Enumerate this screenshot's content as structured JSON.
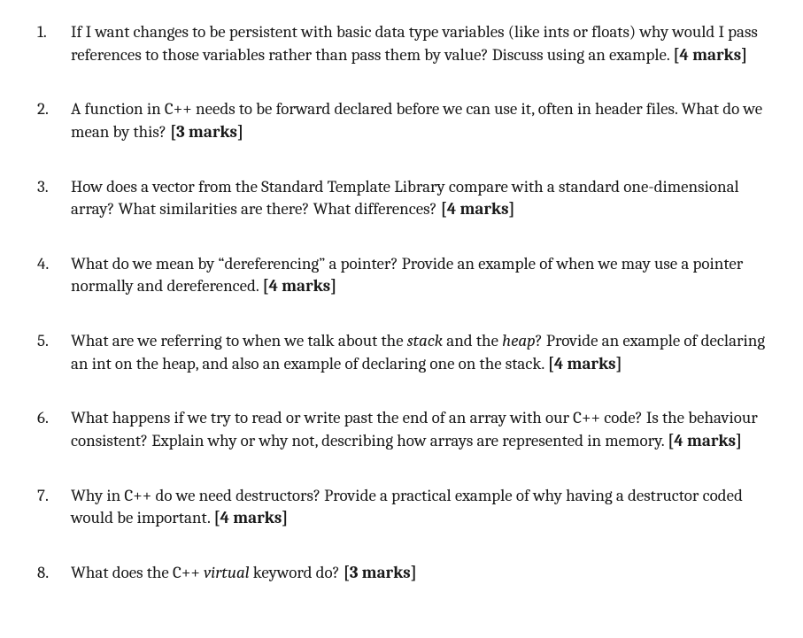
{
  "questions": [
    {
      "text_a": "If I want changes to be persistent with basic data type variables (like ints or floats) why would I pass references to those variables rather than pass them by value? Discuss using an example. ",
      "marks": "[4 marks]"
    },
    {
      "text_a": "A function in C++ needs to be forward declared before we can use it, often in header files. What do we mean by this? ",
      "marks": "[3 marks]"
    },
    {
      "text_a": "How does a vector from the Standard Template Library compare with a standard one-dimensional array? What similarities are there? What differences? ",
      "marks": "[4 marks]"
    },
    {
      "text_a": "What do we mean by “dereferencing” a pointer? Provide an example of when we may use a pointer normally and dereferenced. ",
      "marks": "[4 marks]"
    },
    {
      "text_a": "What are we referring to when we talk about the ",
      "em1": "stack",
      "text_b": " and the ",
      "em2": "heap",
      "text_c": "? Provide an example of declaring an int on the heap, and also an example of declaring one on the stack. ",
      "marks": "[4 marks]"
    },
    {
      "text_a": "What happens if we try to read or write past the end of an array with our C++ code? Is the behaviour consistent? Explain why or why not, describing how arrays are represented in memory. ",
      "marks": "[4 marks]"
    },
    {
      "text_a": "Why in C++ do we need destructors? Provide a practical example of why having a destructor coded would be important. ",
      "marks": "[4 marks]"
    },
    {
      "text_a": "What does the C++ ",
      "em1": "virtual",
      "text_b": " keyword do? ",
      "marks": "[3 marks]"
    }
  ]
}
